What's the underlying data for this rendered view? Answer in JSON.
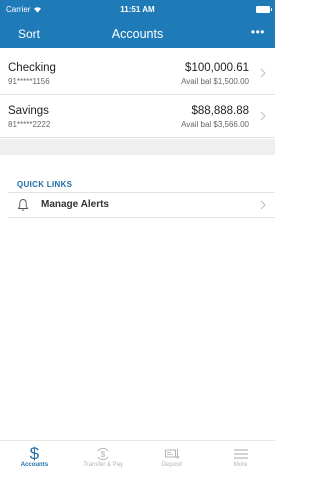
{
  "status_bar": {
    "carrier": "Carrier",
    "time": "11:51 AM"
  },
  "nav": {
    "sort_label": "Sort",
    "title": "Accounts",
    "more_label": "•••"
  },
  "accounts": [
    {
      "name": "Checking",
      "number": "91*****1156",
      "balance": "$100,000.61",
      "available": "Avail bal $1,500.00"
    },
    {
      "name": "Savings",
      "number": "81*****2222",
      "balance": "$88,888.88",
      "available": "Avail bal $3,566.00"
    }
  ],
  "quick_links": {
    "header": "QUICK LINKS",
    "items": [
      {
        "label": "Manage Alerts",
        "icon": "bell-icon"
      }
    ]
  },
  "tab_bar": {
    "tabs": [
      {
        "label": "Accounts",
        "icon": "dollar-icon",
        "active": true
      },
      {
        "label": "Transfer & Pay",
        "icon": "transfer-dollar-icon",
        "active": false
      },
      {
        "label": "Deposit",
        "icon": "check-deposit-icon",
        "active": false
      },
      {
        "label": "More",
        "icon": "menu-icon",
        "active": false
      }
    ]
  },
  "colors": {
    "brand": "#1f7ab8",
    "accent": "#1f6ea8",
    "inactive": "#b3b3b3"
  }
}
